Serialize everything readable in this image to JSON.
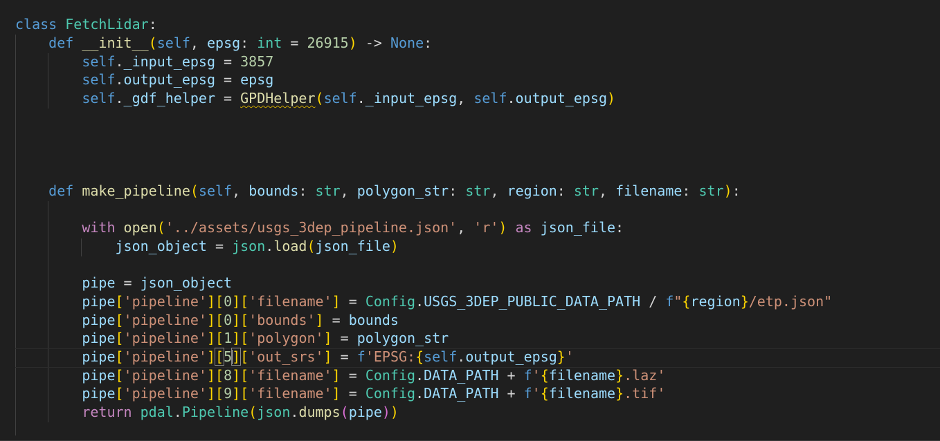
{
  "editor": {
    "language": "python",
    "class_name": "FetchLidar",
    "lines": {
      "l01": "class FetchLidar:",
      "l02": "def __init__(self, epsg: int = 26915) -> None:",
      "l03": "self._input_epsg = 3857",
      "l04": "self.output_epsg = epsg",
      "l05": "self._gdf_helper = GPDHelper(self._input_epsg, self.output_epsg)",
      "l06": "def make_pipeline(self, bounds: str, polygon_str: str, region: str, filename: str):",
      "l07": "with open('../assets/usgs_3dep_pipeline.json', 'r') as json_file:",
      "l08": "json_object = json.load(json_file)",
      "l09": "pipe = json_object",
      "l10": "pipe['pipeline'][0]['filename'] = Config.USGS_3DEP_PUBLIC_DATA_PATH / f\"{region}/etp.json\"",
      "l11": "pipe['pipeline'][0]['bounds'] = bounds",
      "l12": "pipe['pipeline'][1]['polygon'] = polygon_str",
      "l13": "pipe['pipeline'][5]['out_srs'] = f'EPSG:{self.output_epsg}'",
      "l14": "pipe['pipeline'][8]['filename'] = Config.DATA_PATH + f'{filename}.laz'",
      "l15": "pipe['pipeline'][9]['filename'] = Config.DATA_PATH + f'{filename}.tif'",
      "l16": "return pdal.Pipeline(json.dumps(pipe))"
    },
    "warning_symbol": "GPDHelper",
    "cursor_line": "l13",
    "colors": {
      "background": "#1f1f1f",
      "keyword": "#569cd6",
      "control_keyword": "#c586c0",
      "class": "#4ec9b0",
      "function": "#dcdcaa",
      "variable": "#9cdcfe",
      "string": "#ce9178",
      "number": "#b5cea8",
      "bracket_level1": "#ffd700",
      "bracket_level2": "#da70d6",
      "bracket_level3": "#179fff",
      "warning_squiggle": "#cca700"
    }
  }
}
